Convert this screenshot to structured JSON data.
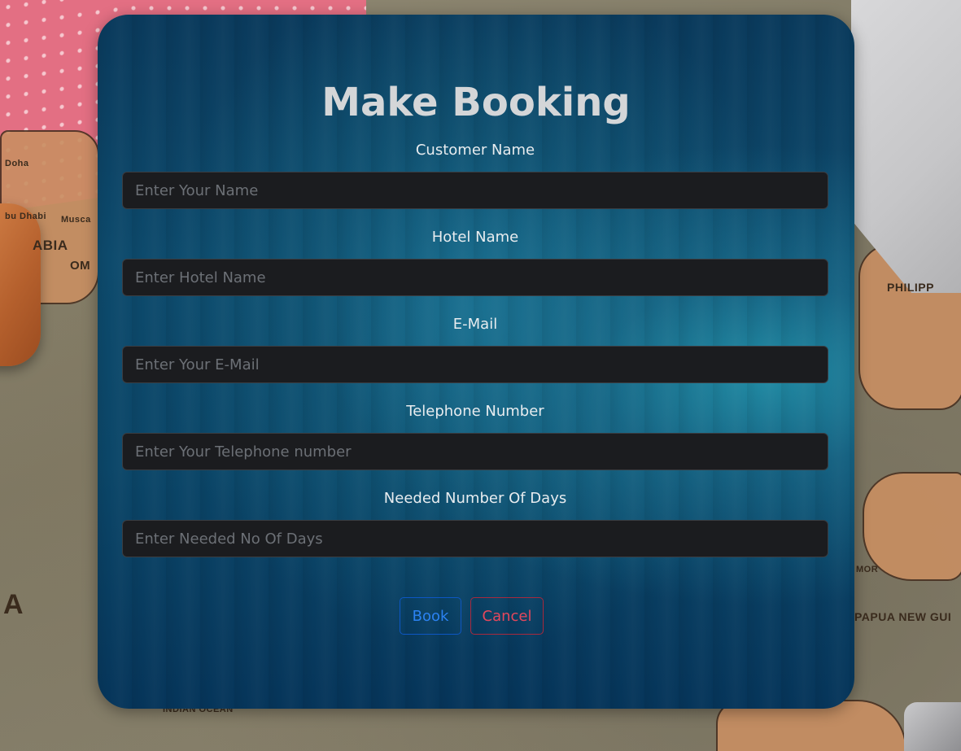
{
  "form": {
    "title": "Make Booking",
    "fields": [
      {
        "label": "Customer Name",
        "placeholder": "Enter Your Name",
        "value": ""
      },
      {
        "label": "Hotel Name",
        "placeholder": "Enter Hotel Name",
        "value": ""
      },
      {
        "label": "E-Mail",
        "placeholder": "Enter Your E-Mail",
        "value": ""
      },
      {
        "label": "Telephone Number",
        "placeholder": "Enter Your Telephone number",
        "value": ""
      },
      {
        "label": "Needed Number Of Days",
        "placeholder": "Enter Needed No Of Days",
        "value": ""
      }
    ],
    "buttons": {
      "book_label": "Book",
      "cancel_label": "Cancel"
    }
  },
  "background_map": {
    "labels": [
      "Doha",
      "bu Dhabi",
      "Musca",
      "ABIA",
      "OM",
      "PHILIPP",
      "MOR",
      "PAPUA NEW GUI",
      "A",
      "INDIAN OCEAN"
    ]
  },
  "colors": {
    "card_dark": "#0a3a5c",
    "card_glow": "#218ba4",
    "input_bg": "#1b1c1f",
    "book_accent": "#2b82f2",
    "cancel_accent": "#e4475c"
  }
}
